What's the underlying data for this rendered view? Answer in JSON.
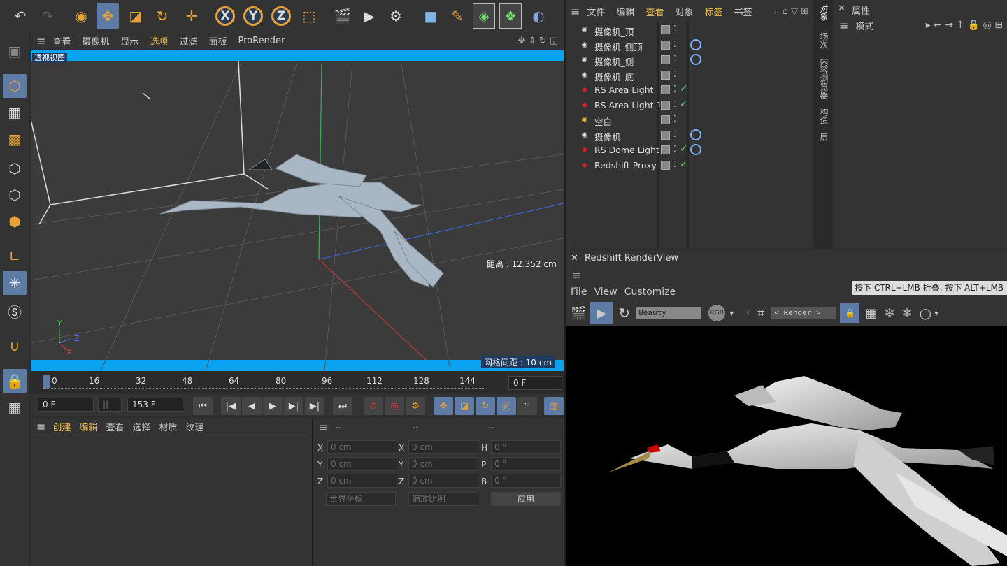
{
  "toolbar": {
    "icons": [
      "undo-icon",
      "redo-icon",
      "live-select-icon",
      "move-icon",
      "scale-icon",
      "rotate-icon",
      "transform-icon",
      "x-axis-icon",
      "y-axis-icon",
      "z-axis-icon",
      "coordinate-system-icon",
      "render-view-icon",
      "render-picture-viewer-icon",
      "render-settings-icon",
      "cube-icon",
      "pen-icon",
      "subdivision-icon",
      "array-icon",
      "deformer-icon"
    ],
    "x_label": "X",
    "y_label": "Y",
    "z_label": "Z"
  },
  "viewport": {
    "menu": [
      "查看",
      "摄像机",
      "显示",
      "选项",
      "过滤",
      "面板",
      "ProRender"
    ],
    "active_menu": "选项",
    "label": "透视视图",
    "distance": "距离 : 12.352 cm",
    "grid": "网格间距 : 10 cm",
    "axis_y": "Y",
    "axis_z": "Z",
    "axis_x": "X"
  },
  "timeline": {
    "ticks": [
      "0",
      "16",
      "32",
      "48",
      "64",
      "80",
      "96",
      "112",
      "128",
      "144"
    ],
    "current_frame": "0 F",
    "start": "0 F",
    "end": "153 F"
  },
  "material": {
    "menu": [
      "创建",
      "编辑",
      "查看",
      "选择",
      "材质",
      "纹理"
    ]
  },
  "coords": {
    "header": [
      "--",
      "--",
      "--"
    ],
    "rows": [
      {
        "a": "X",
        "av": "0 cm",
        "b": "X",
        "bv": "0 cm",
        "c": "H",
        "cv": "0 °"
      },
      {
        "a": "Y",
        "av": "0 cm",
        "b": "Y",
        "bv": "0 cm",
        "c": "P",
        "cv": "0 °"
      },
      {
        "a": "Z",
        "av": "0 cm",
        "b": "Z",
        "bv": "0 cm",
        "c": "B",
        "cv": "0 °"
      }
    ],
    "world": "世界坐标",
    "scale": "缩放比例",
    "apply": "应用"
  },
  "objects": {
    "menu": [
      "文件",
      "编辑",
      "查看",
      "对象",
      "标签",
      "书签"
    ],
    "items": [
      {
        "name": "摄像机_顶",
        "type": "camera",
        "tag": false,
        "check": false
      },
      {
        "name": "摄像机_侧顶",
        "type": "camera",
        "tag": true,
        "check": false
      },
      {
        "name": "摄像机_侧",
        "type": "camera",
        "tag": true,
        "check": false
      },
      {
        "name": "摄像机_底",
        "type": "camera",
        "tag": false,
        "check": false
      },
      {
        "name": "RS Area Light",
        "type": "rs",
        "tag": false,
        "check": true
      },
      {
        "name": "RS Area Light.1",
        "type": "rs",
        "tag": false,
        "check": true
      },
      {
        "name": "空白",
        "type": "null",
        "tag": false,
        "check": false
      },
      {
        "name": "摄像机",
        "type": "camera",
        "tag": true,
        "check": false
      },
      {
        "name": "RS Dome Light",
        "type": "rs",
        "tag": true,
        "check": true
      },
      {
        "name": "Redshift Proxy",
        "type": "rs",
        "tag": false,
        "check": true
      }
    ]
  },
  "side_tabs": [
    "对象",
    "场次",
    "内容浏览器",
    "构造",
    "层"
  ],
  "attributes": {
    "title": "属性",
    "mode": "模式"
  },
  "renderview": {
    "title": "Redshift RenderView",
    "menu": [
      "File",
      "View",
      "Customize"
    ],
    "tooltip": "按下 CTRL+LMB 折叠, 按下 ALT+LMB",
    "aov": "Beauty",
    "rgb": "RGB",
    "render": "< Render >"
  },
  "colors": {
    "accent": "#e8a23a",
    "select": "#5e7ba6",
    "viewport_bar": "#09a3f0"
  }
}
